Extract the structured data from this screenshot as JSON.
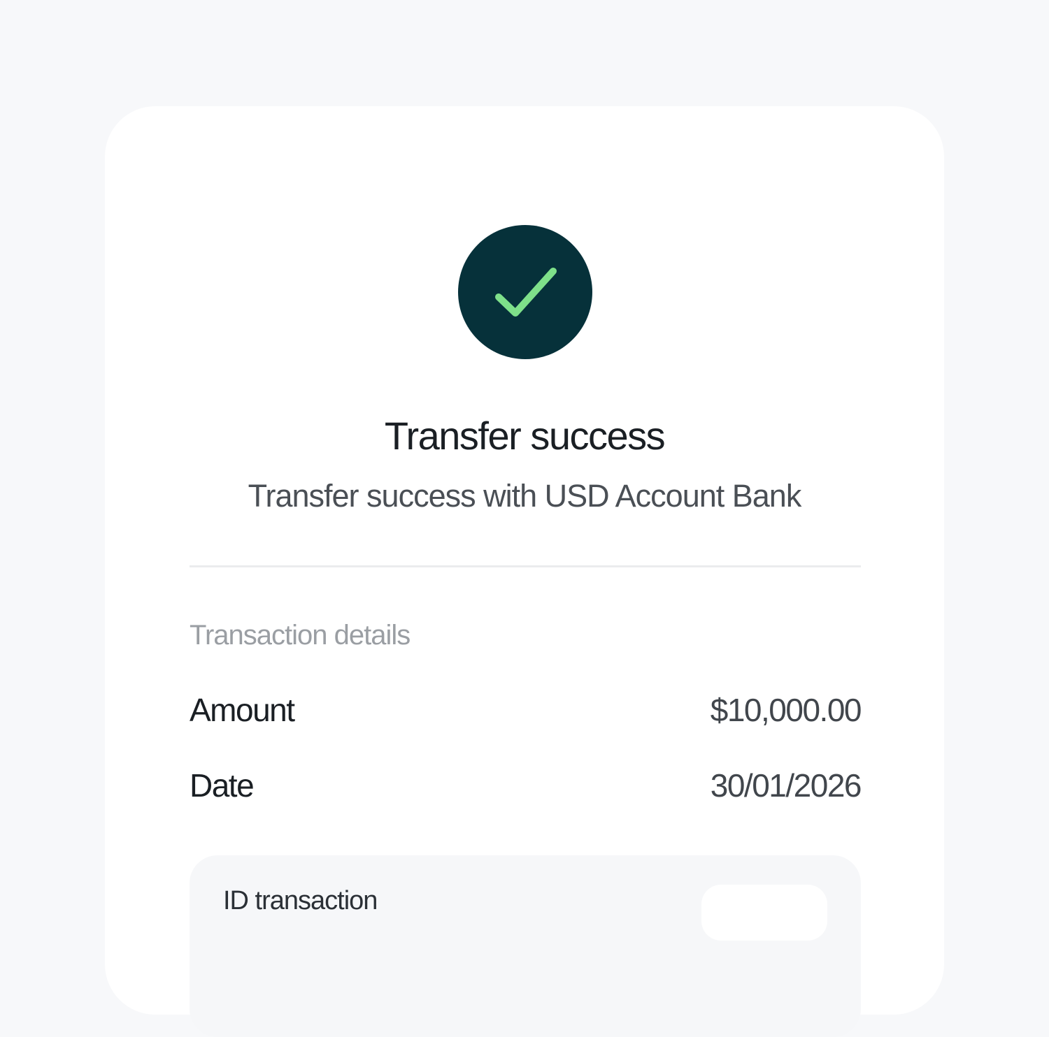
{
  "colors": {
    "page_background": "#f7f8fa",
    "card_background": "#ffffff",
    "badge_background": "#06313a",
    "check_color": "#7ee08a"
  },
  "status": {
    "icon": "check-icon",
    "title": "Transfer success",
    "subtitle": "Transfer success with USD Account Bank"
  },
  "details": {
    "section_label": "Transaction details",
    "amount_label": "Amount",
    "amount_value": "$10,000.00",
    "date_label": "Date",
    "date_value": "30/01/2026"
  },
  "transaction_id": {
    "label": "ID transaction"
  }
}
